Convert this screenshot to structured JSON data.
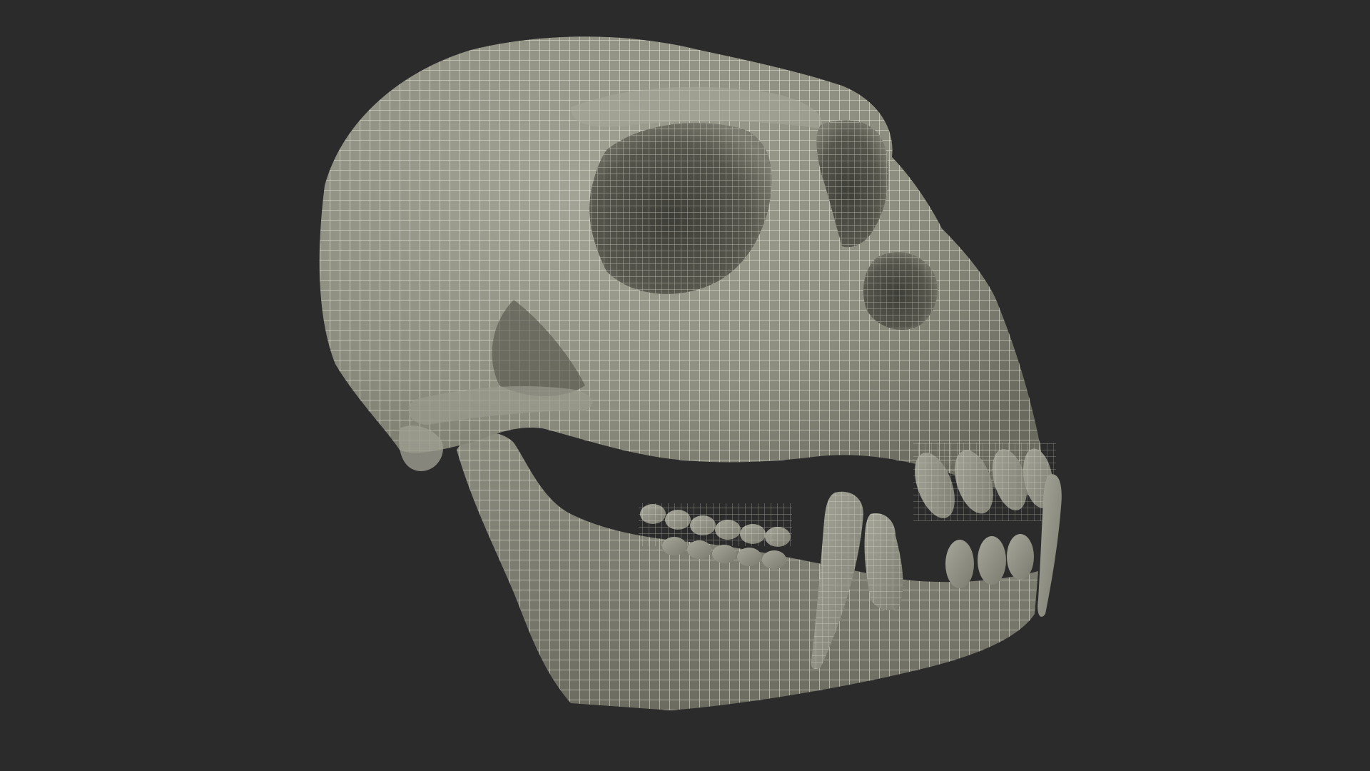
{
  "scene": {
    "subject": "primate-skull-wireframe",
    "background_color": "#2b2b2b",
    "surface_color": "#8e8e80",
    "surface_shadow_color": "#5f5f55",
    "surface_dark_color": "#3e3e38",
    "wire_color": "#f2f2e6"
  }
}
